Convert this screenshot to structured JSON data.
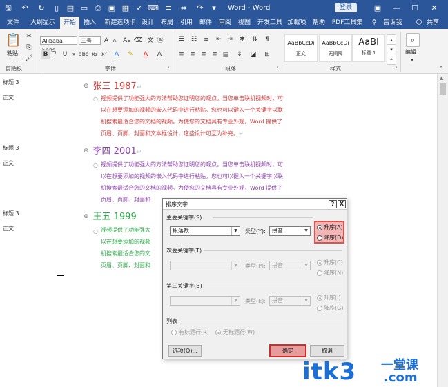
{
  "titlebar": {
    "doc_title": "Word - Word",
    "login": "登录",
    "bg_color": "#2b579a"
  },
  "tabs": [
    "文件",
    "大纲显示",
    "开始",
    "插入",
    "新建选项卡",
    "设计",
    "布局",
    "引用",
    "邮件",
    "审阅",
    "视图",
    "开发工具",
    "加载项",
    "帮助",
    "PDF工具集",
    "告诉我",
    "共享"
  ],
  "ribbon": {
    "paste_label": "粘贴",
    "font_name": "Alibaba Sans",
    "font_size": "三号",
    "font_size_grow": "A",
    "font_size_shrink": "A",
    "aa_label": "Aa",
    "groups": {
      "clipboard": "剪贴板",
      "font": "字体",
      "paragraph": "段落",
      "styles": "样式"
    },
    "styles": [
      {
        "sample": "AaBbCcDi",
        "name": "正文"
      },
      {
        "sample": "AaBbCcDi",
        "name": "无间隔"
      },
      {
        "sample": "AaBl",
        "name": "标题 1"
      }
    ],
    "edit_label": "编辑"
  },
  "nav": [
    "标题 3",
    "正文",
    "标题 3",
    "正文",
    "标题 3",
    "正文"
  ],
  "doc": {
    "h1": "张三 1987",
    "h2": "李四 2001",
    "h3": "王五 1999",
    "p1": [
      "视频提供了功能强大的方法帮助您证明您的观点。当您单击联机视频时，可",
      "以在想要添加的视频的嵌入代码中进行粘贴。您也可以键入一个关键字以联",
      "机搜索最适合您的文档的视频。为使您的文档具有专业外观，Word 提供了",
      "页眉、页脚、封面和文本框设计，这些设计可互为补充。"
    ],
    "p2": [
      "视频提供了功能强大的方法帮助您证明您的观点。当您单击联机视频时，可",
      "以在想要添加的视频的嵌入代码中进行粘贴。您也可以键入一个关键字以联",
      "机搜索最适合您的文档的视频。为使您的文档具有专业外观，Word 提供了",
      "页眉、页脚、封面和"
    ],
    "p3": [
      "视频提供了功能强大",
      "以在想要添加的视频",
      "机搜索最适合您的文",
      "页眉、页脚、封面和"
    ],
    "colors": {
      "c1": "#d73a3a",
      "c2": "#8e44ad",
      "c3": "#2eaa4a"
    }
  },
  "dialog": {
    "title": "排序文字",
    "help": "?",
    "close": "X",
    "key1": {
      "label": "主要关键字(S)",
      "value": "段落数",
      "type_label": "类型(Y):",
      "type_value": "拼音",
      "asc": "升序(A)",
      "desc": "降序(D)"
    },
    "key2": {
      "label": "次要关键字(T)",
      "value": "",
      "type_label": "类型(P):",
      "type_value": "拼音",
      "asc": "升序(C)",
      "desc": "降序(N)"
    },
    "key3": {
      "label": "第三关键字(B)",
      "value": "",
      "type_label": "类型(E):",
      "type_value": "拼音",
      "asc": "升序(I)",
      "desc": "降序(G)"
    },
    "list": {
      "label": "列表",
      "opt1": "有标题行(R)",
      "opt2": "无标题行(W)"
    },
    "options_btn": "选项(O)...",
    "ok_btn": "确定",
    "cancel_btn": "取消",
    "highlight_color": "#d9534f"
  },
  "watermark": {
    "brand": "itk3",
    "tag": "一堂课",
    "domain": ".com",
    "color": "#1a6fd8"
  }
}
